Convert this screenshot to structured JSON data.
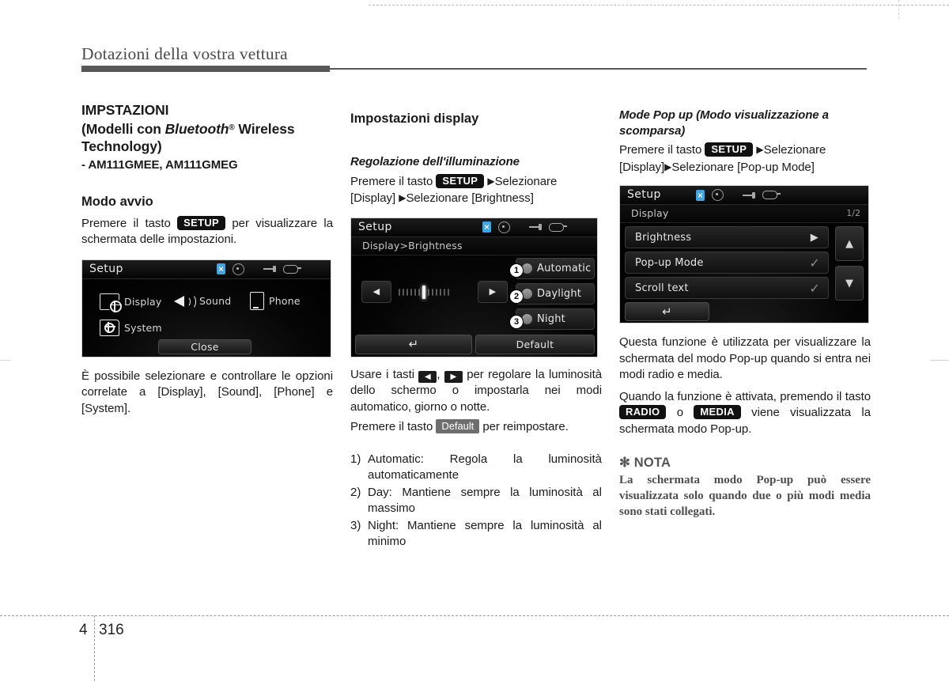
{
  "header": {
    "running_title": "Dotazioni della vostra vettura"
  },
  "footer": {
    "chapter": "4",
    "page": "316"
  },
  "column_left": {
    "section_title_line1": "IMPSTAZIONI",
    "section_title_line2_pre": "(Modelli con ",
    "section_title_bluetooth": "Bluetooth",
    "section_title_reg": "®",
    "section_title_line2_post": " Wireless",
    "section_title_line3": "Technology)",
    "models": "- AM111GMEE, AM111GMEG",
    "subtitle": "Modo avvio",
    "para_pre": "Premere il tasto",
    "key_setup": "SETUP",
    "para_post": "per visualizzare la schermata delle impostazioni.",
    "caption": "È possibile selezionare e controllare le opzioni correlate a [Display], [Sound], [Phone] e [System].",
    "screen": {
      "title": "Setup",
      "tiles": [
        {
          "label": "Display",
          "icon": "display-gear-icon"
        },
        {
          "label": "Sound",
          "icon": "speaker-icon"
        },
        {
          "label": "Phone",
          "icon": "phone-icon"
        },
        {
          "label": "System",
          "icon": "folder-gear-icon"
        }
      ],
      "close_button": "Close"
    }
  },
  "column_middle": {
    "subtitle": "Impostazioni display",
    "italic_title": "Regolazione dell'illuminazione",
    "path_pre": "Premere il tasto",
    "key_setup": "SETUP",
    "path_mid": "Selezionare",
    "path_line2_a": "[Display]",
    "path_line2_b": "Selezionare [Brightness]",
    "screen": {
      "title": "Setup",
      "breadcrumb": "Display>Brightness",
      "options": [
        {
          "num": "1",
          "label": "Automatic"
        },
        {
          "num": "2",
          "label": "Daylight"
        },
        {
          "num": "3",
          "label": "Night"
        }
      ],
      "back_button": "back-arrow",
      "default_button": "Default",
      "slider_ticks": 13,
      "slider_active_index": 6
    },
    "usage_pre": "Usare i tasti",
    "usage_key_left": "◀",
    "usage_key_right": "▶",
    "usage_post": "per regolare la luminosità dello schermo o impostarla nei modi automatico, giorno o notte.",
    "reset_pre": "Premere il tasto",
    "reset_key": "Default",
    "reset_post": "per reimpostare.",
    "list": [
      {
        "num": "1)",
        "text": "Automatic: Regola la luminosità automaticamente"
      },
      {
        "num": "2)",
        "text": "Day: Mantiene sempre la luminosità al massimo"
      },
      {
        "num": "3)",
        "text": "Night: Mantiene sempre la luminosità al minimo"
      }
    ]
  },
  "column_right": {
    "italic_title_line1": "Mode Pop up (Modo visualizzazione a",
    "italic_title_line2": "scomparsa)",
    "path_pre": "Premere il tasto",
    "key_setup": "SETUP",
    "path_mid": "Selezionare",
    "path_line2_a": "[Display]",
    "path_line2_b": "Selezionare [Pop-up Mode]",
    "screen": {
      "title": "Setup",
      "breadcrumb": "Display",
      "page_indicator": "1/2",
      "rows": [
        {
          "label": "Brightness",
          "control": "arrow"
        },
        {
          "label": "Pop-up Mode",
          "control": "check"
        },
        {
          "label": "Scroll text",
          "control": "check"
        }
      ],
      "back_button": "back-arrow",
      "scroll_up": "▲",
      "scroll_down": "▼"
    },
    "para1": "Questa funzione è utilizzata per visualizzare la schermata del modo Pop-up quando si entra nei modi radio e media.",
    "para2_pre": "Quando la funzione è attivata, premendo il tasto",
    "key_radio": "RADIO",
    "para2_mid": "o",
    "key_media": "MEDIA",
    "para2_post": "viene visualizzata la schermata modo Pop-up.",
    "nota_head": "✻ NOTA",
    "nota_body": "La schermata modo Pop-up può essere visualizzata solo quando due o più modi media sono stati collegati."
  }
}
